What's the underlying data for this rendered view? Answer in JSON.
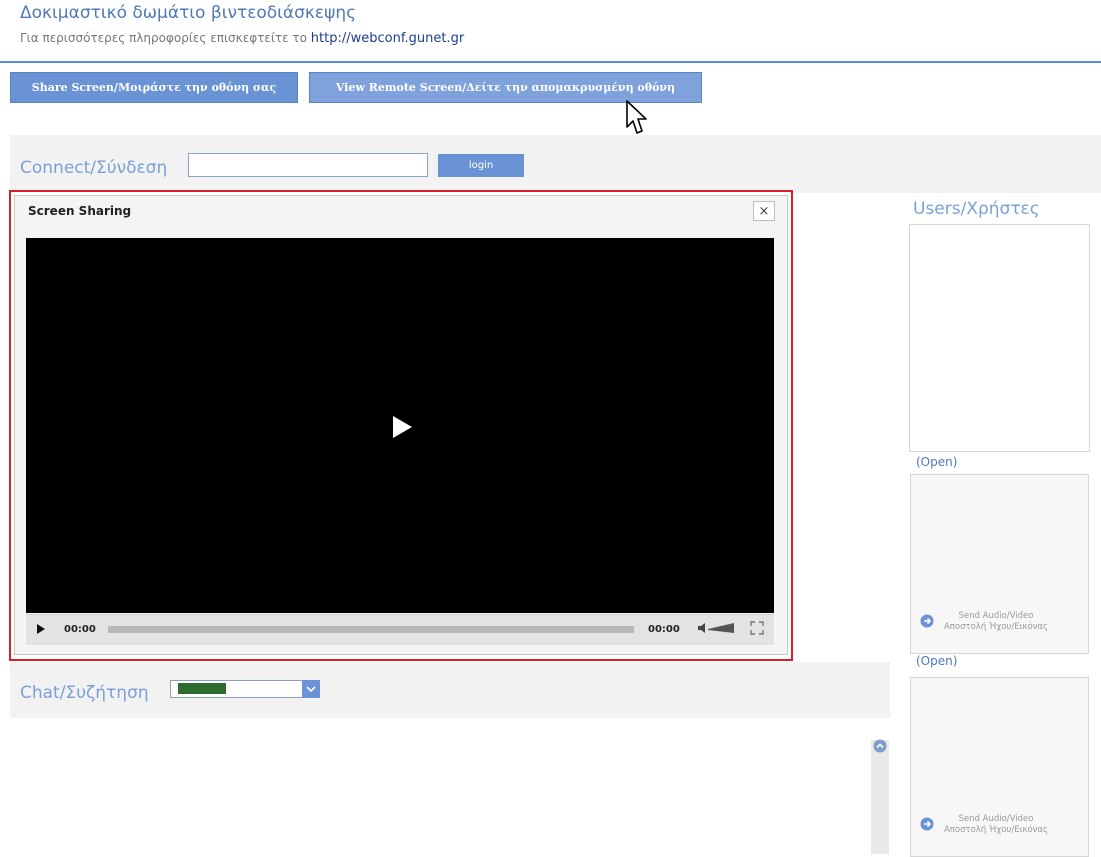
{
  "header": {
    "title": "Δοκιμαστικό δωμάτιο βιντεοδιάσκεψης",
    "subtitle_prefix": "Για περισσότερες πληροφορίες επισκεφτείτε το",
    "link_text": "http://webconf.gunet.gr"
  },
  "toolbar": {
    "share_label": "Share Screen/Μοιράστε την οθόνη σας",
    "view_label": "View Remote Screen/Δείτε την απομακρυσμένη οθόνη"
  },
  "connect": {
    "label": "Connect/Σύνδεση",
    "input_value": "",
    "login_label": "login"
  },
  "screen_sharing": {
    "title": "Screen Sharing",
    "close_glyph": "×",
    "time_start": "00:00",
    "time_end": "00:00"
  },
  "users": {
    "label": "Users/Χρήστες",
    "open_1": "(Open)",
    "open_2": "(Open)",
    "send_av_en": "Send Audio/Video",
    "send_av_gr": "Αποστολή Ήχου/Εικόνας"
  },
  "chat": {
    "label": "Chat/Συζήτηση",
    "selected_color": "#2e6b2e"
  },
  "colors": {
    "accent": "#6a93d6",
    "highlight_frame": "#d81e2c"
  },
  "icons": [
    "mouse-cursor-icon",
    "play-icon",
    "volume-icon",
    "fullscreen-icon",
    "close-icon",
    "arrow-right-circle-icon",
    "dropdown-arrow-icon",
    "scroll-up-icon"
  ]
}
